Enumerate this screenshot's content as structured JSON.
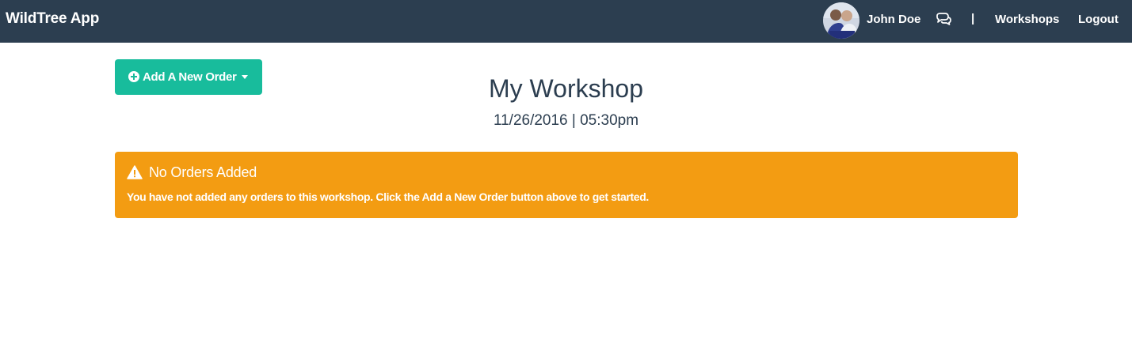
{
  "navbar": {
    "brand": "WildTree App",
    "user_name": "John Doe",
    "separator": "|",
    "links": {
      "workshops": "Workshops",
      "logout": "Logout"
    },
    "bg_color": "#2c3e50"
  },
  "toolbar": {
    "add_order_label": "Add A New Order",
    "add_order_color": "#18bc9c"
  },
  "page": {
    "title": "My Workshop",
    "subtitle": "11/26/2016 | 05:30pm"
  },
  "alert": {
    "title": "No Orders Added",
    "text_before": "You have not added any orders to this workshop. Click the ",
    "text_bold": "Add a New Order",
    "text_after": " button above to get started.",
    "color": "#f39c12"
  },
  "icons": [
    "avatar",
    "chat-icon",
    "plus-circle-icon",
    "caret-down-icon",
    "warning-icon"
  ]
}
